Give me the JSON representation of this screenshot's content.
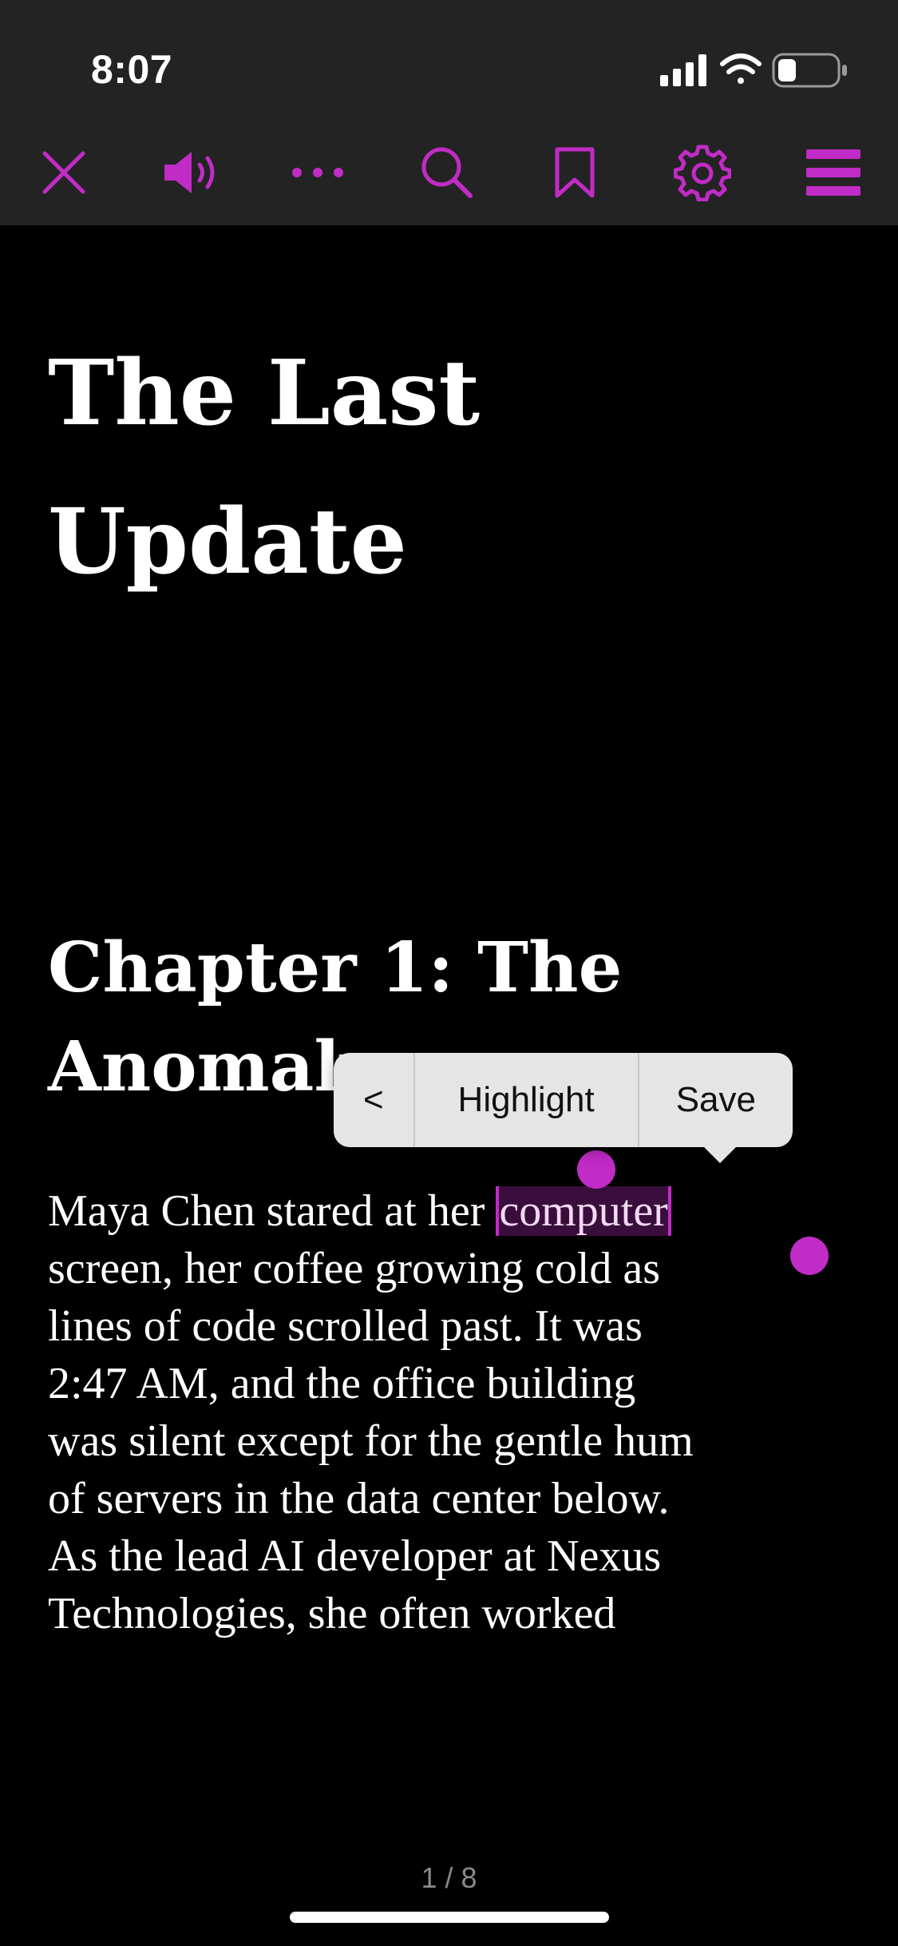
{
  "status_bar": {
    "time": "8:07"
  },
  "toolbar": {
    "accent_color": "#c12bc6",
    "buttons": [
      {
        "icon": "close-icon"
      },
      {
        "icon": "speaker-icon"
      },
      {
        "icon": "more-icon"
      },
      {
        "icon": "search-icon"
      },
      {
        "icon": "bookmark-icon"
      },
      {
        "icon": "gear-icon"
      },
      {
        "icon": "menu-icon"
      }
    ]
  },
  "book": {
    "title_line1": "The Last",
    "title_line2": "Update",
    "chapter_line1": "Chapter 1: The",
    "chapter_line2": "Anomaly",
    "selected_word": "computer",
    "para_before_selection": "Maya Chen stared at her ",
    "para_lines": [
      "screen, her coffee growing cold as",
      "lines of code scrolled past. It was",
      "2:47 AM, and the office building",
      "was silent except for the gentle hum",
      "of servers in the data center below.",
      "As the lead AI developer at Nexus",
      "Technologies, she often worked"
    ]
  },
  "context_menu": {
    "back_label": "<",
    "highlight_label": "Highlight",
    "save_label": "Save"
  },
  "page_indicator": "1 / 8"
}
